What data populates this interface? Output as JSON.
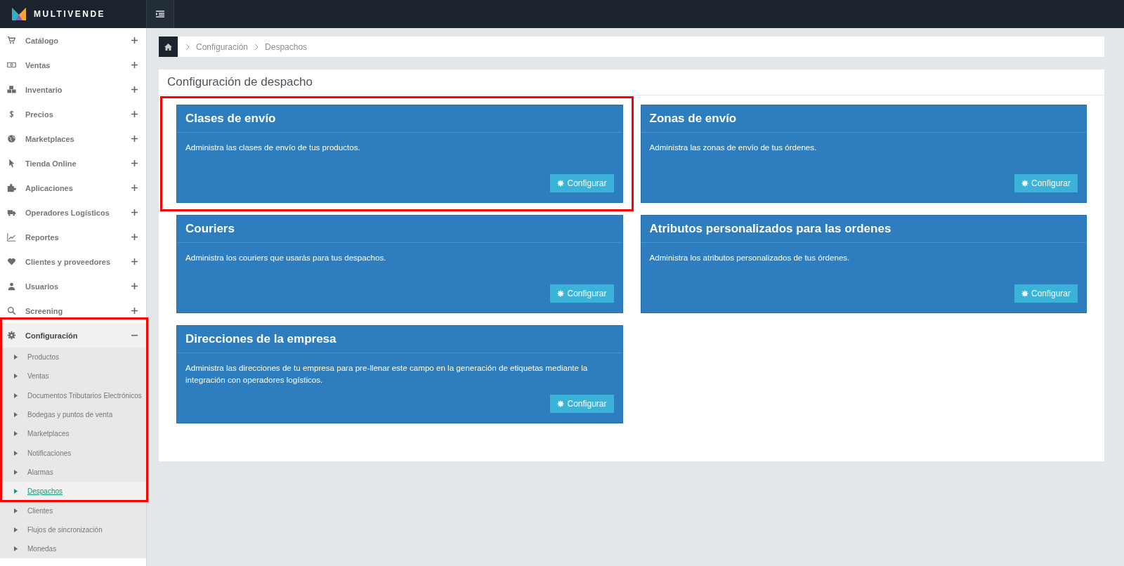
{
  "header": {
    "brand": "MULTIVENDE"
  },
  "sidebar": {
    "items": [
      {
        "label": "Catálogo",
        "expanded": false
      },
      {
        "label": "Ventas",
        "expanded": false
      },
      {
        "label": "Inventario",
        "expanded": false
      },
      {
        "label": "Precios",
        "expanded": false
      },
      {
        "label": "Marketplaces",
        "expanded": false
      },
      {
        "label": "Tienda Online",
        "expanded": false
      },
      {
        "label": "Aplicaciones",
        "expanded": false
      },
      {
        "label": "Operadores Logísticos",
        "expanded": false
      },
      {
        "label": "Reportes",
        "expanded": false
      },
      {
        "label": "Clientes y proveedores",
        "expanded": false
      },
      {
        "label": "Usuarios",
        "expanded": false
      },
      {
        "label": "Screening",
        "expanded": false
      },
      {
        "label": "Configuración",
        "expanded": true,
        "highlighted": true,
        "children": [
          {
            "label": "Productos",
            "selected": false
          },
          {
            "label": "Ventas",
            "selected": false
          },
          {
            "label": "Documentos Tributarios Electrónicos",
            "selected": false
          },
          {
            "label": "Bodegas y puntos de venta",
            "selected": false
          },
          {
            "label": "Marketplaces",
            "selected": false
          },
          {
            "label": "Notificaciones",
            "selected": false
          },
          {
            "label": "Alarmas",
            "selected": false
          },
          {
            "label": "Despachos",
            "selected": true
          },
          {
            "label": "Clientes",
            "selected": false
          },
          {
            "label": "Flujos de sincronización",
            "selected": false
          },
          {
            "label": "Monedas",
            "selected": false
          }
        ]
      }
    ]
  },
  "breadcrumb": [
    "Configuración",
    "Despachos"
  ],
  "panel": {
    "title": "Configuración de despacho",
    "cards": [
      {
        "title": "Clases de envío",
        "description": "Administra las clases de envío de tus productos.",
        "button": "Configurar",
        "highlighted": true
      },
      {
        "title": "Zonas de envío",
        "description": "Administra las zonas de envío de tus órdenes.",
        "button": "Configurar",
        "highlighted": false
      },
      {
        "title": "Couriers",
        "description": "Administra los couriers que usarás para tus despachos.",
        "button": "Configurar",
        "highlighted": false
      },
      {
        "title": "Atributos personalizados para las ordenes",
        "description": "Administra los atributos personalizados de tus órdenes.",
        "button": "Configurar",
        "highlighted": false
      },
      {
        "title": "Direcciones de la empresa",
        "description": "Administra las direcciones de tu empresa para pre-llenar este campo en la generación de etiquetas mediante la integración con operadores logísticos.",
        "button": "Configurar",
        "highlighted": false
      }
    ]
  }
}
